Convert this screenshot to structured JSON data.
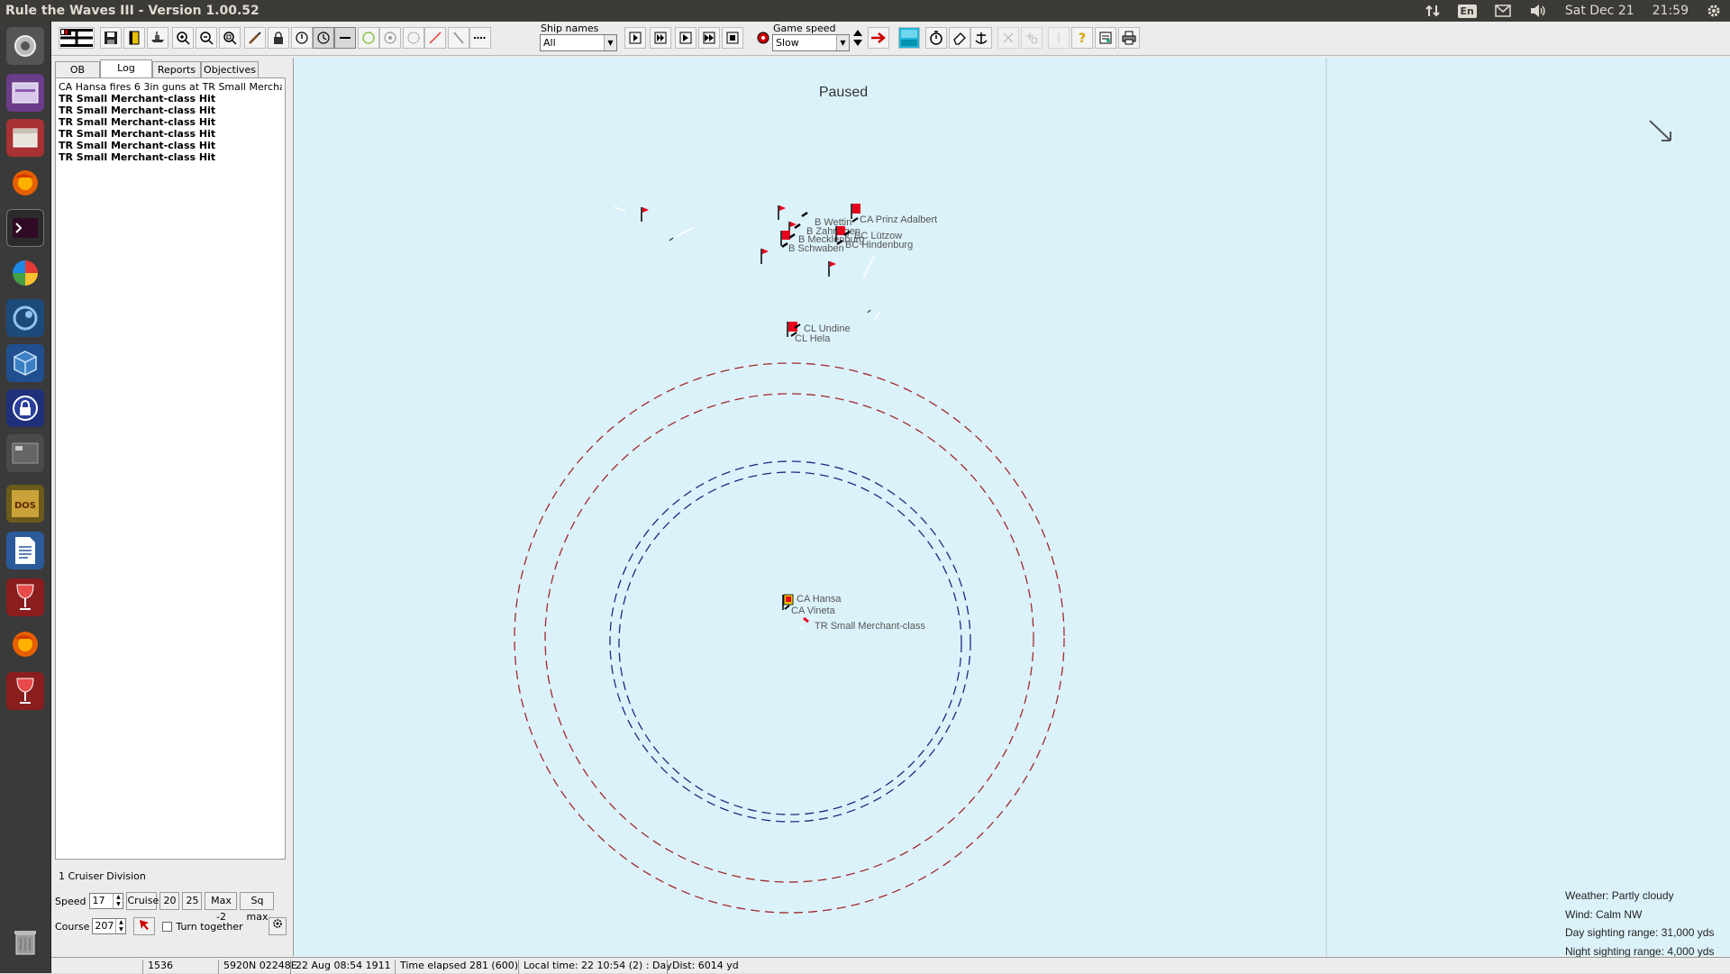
{
  "topbar": {
    "title": "Rule the Waves III - Version 1.00.52",
    "keyboard": "En",
    "date": "Sat Dec 21",
    "time": "21:59"
  },
  "launcher": {
    "items": [
      "dash-icon",
      "workspace-icon",
      "files-icon",
      "firefox-icon",
      "terminal-icon",
      "color-picker-icon",
      "steam-icon",
      "virtualbox-icon",
      "lock-icon",
      "window-icon",
      "dosbox-icon",
      "writer-icon",
      "wine-icon",
      "firefox-icon",
      "wine-icon",
      "trash-icon"
    ]
  },
  "toolbar": {
    "ship_names_label": "Ship names",
    "ship_names_value": "All",
    "game_speed_label": "Game speed",
    "game_speed_value": "Slow"
  },
  "tabs": [
    "OB",
    "Log",
    "Reports",
    "Objectives"
  ],
  "log": [
    {
      "text": "CA Hansa fires 6 3in guns at TR Small Merchant-class",
      "bold": false
    },
    {
      "text": "TR Small Merchant-class Hit",
      "bold": true
    },
    {
      "text": "TR Small Merchant-class Hit",
      "bold": true
    },
    {
      "text": "TR Small Merchant-class Hit",
      "bold": true
    },
    {
      "text": "TR Small Merchant-class Hit",
      "bold": true
    },
    {
      "text": "TR Small Merchant-class Hit",
      "bold": true
    },
    {
      "text": "TR Small Merchant-class Hit",
      "bold": true
    }
  ],
  "controls": {
    "division": "1 Cruiser Division",
    "speed_label": "Speed",
    "speed_value": "17",
    "cruise_label": "Cruise",
    "speed20": "20",
    "speed25": "25",
    "max2": "Max -2",
    "sqmax": "Sq max",
    "course_label": "Course",
    "course_value": "207",
    "turn_together": "Turn together"
  },
  "map": {
    "paused": "Paused",
    "labels": {
      "wettin": "B Wettin",
      "zahringen": "B Zahringen",
      "mecklenburg": "B Mecklenburg",
      "schwaben": "B Schwaben",
      "prinz_adalbert": "CA Prinz Adalbert",
      "lutzow": "BC Lützow",
      "hindenburg": "BC Hindenburg",
      "undine": "CL Undine",
      "hela": "CL Hela",
      "hansa": "CA Hansa",
      "vineta": "CA Vineta",
      "merchant": "TR Small Merchant-class"
    },
    "weather": "Weather: Partly cloudy",
    "wind": "Wind: Calm  NW",
    "day_sight": "Day sighting range: 31,000 yds",
    "night_sight": "Night sighting range: 4,000 yds",
    "colors": {
      "sea": "#dcf2fa",
      "flag": "#e8001c",
      "red_ring": "#a0282c",
      "blue_ring": "#1c2a80"
    }
  },
  "status": {
    "turn": "1536",
    "position": "5920N 02248E",
    "date": "22 Aug 08:54 1911",
    "elapsed": "Time elapsed 281 (600)",
    "local": "Local time: 22 10:54 (2) : Day",
    "dist": "Dist: 6014 yd"
  }
}
